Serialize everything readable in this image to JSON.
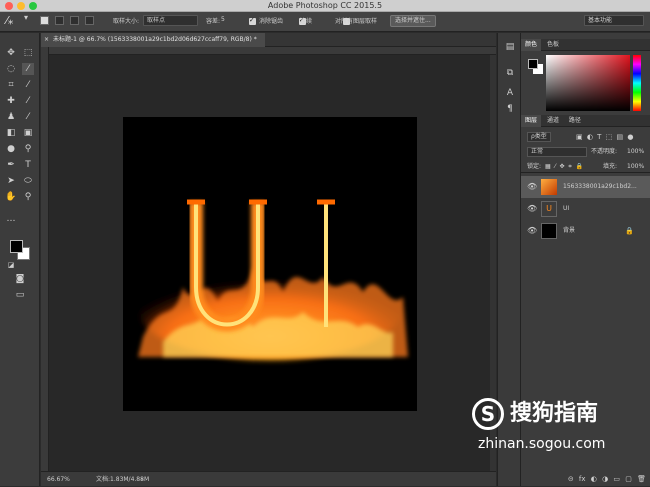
{
  "window": {
    "title": "Adobe Photoshop CC 2015.5"
  },
  "options_bar": {
    "sample_size_label": "取样大小:",
    "sample_size_value": "取样点",
    "tolerance_label": "容差:",
    "tolerance_value": "5",
    "antialias_label": "消除锯齿",
    "contiguous_label": "连续",
    "sample_all_label": "对所有图层取样",
    "select_mask_button": "选择并遮住...",
    "workspace_value": "基本功能"
  },
  "document": {
    "tab_label": "未标题-1 @ 66.7% (1563338001a29c1bd2d06d627ccaff79, RGB/8) *",
    "artwork_text": "UI"
  },
  "status_bar": {
    "zoom": "66.67%",
    "doc_info": "文档:1.83M/4.88M"
  },
  "color_panel": {
    "tabs": [
      "颜色",
      "色板"
    ]
  },
  "layers_panel": {
    "tabs": [
      "图层",
      "通道",
      "路径"
    ],
    "filter_label": "ρ类型",
    "blend_mode": "正常",
    "opacity_label": "不透明度:",
    "opacity_value": "100%",
    "lock_label": "锁定:",
    "fill_label": "填充:",
    "fill_value": "100%",
    "layers": [
      {
        "name": "1563338001a29c1bd2..."
      },
      {
        "name": "UI"
      },
      {
        "name": "背景"
      }
    ]
  },
  "watermark": {
    "brand": "搜狗指南",
    "url": "zhinan.sogou.com"
  },
  "colors": {
    "fire": "#ff7a1a",
    "accent": "#e0141e"
  }
}
